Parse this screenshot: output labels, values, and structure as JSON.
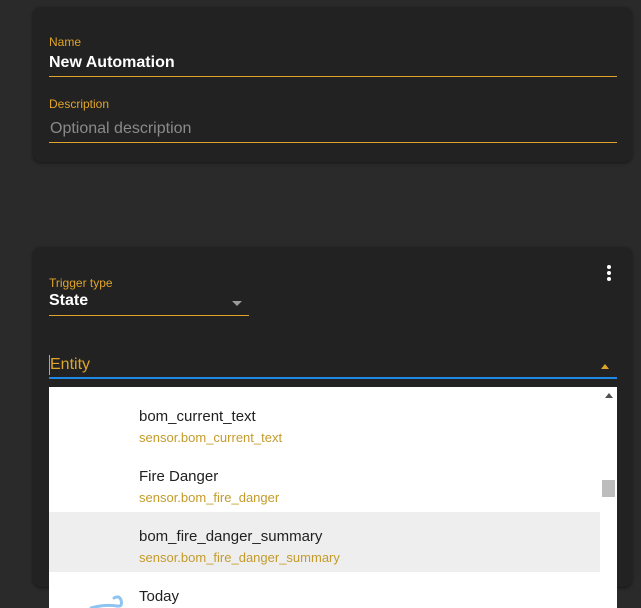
{
  "automation": {
    "name_label": "Name",
    "name_value": "New Automation",
    "description_label": "Description",
    "description_placeholder": "Optional description"
  },
  "trigger": {
    "type_label": "Trigger type",
    "type_value": "State",
    "entity_placeholder": "Entity"
  },
  "entity_options": [
    {
      "name": "bom_current_text",
      "entity_id": "sensor.bom_current_text",
      "icon": "none"
    },
    {
      "name": "Fire Danger",
      "entity_id": "sensor.bom_fire_danger",
      "icon": "none"
    },
    {
      "name": "bom_fire_danger_summary",
      "entity_id": "sensor.bom_fire_danger_summary",
      "icon": "none",
      "highlighted": true
    },
    {
      "name": "Today",
      "entity_id": "",
      "icon": "weather-windy-icon"
    }
  ],
  "colors": {
    "accent": "#e0a42a",
    "focus": "#1e88e5",
    "card": "#222222",
    "background": "#2a2a2a"
  }
}
